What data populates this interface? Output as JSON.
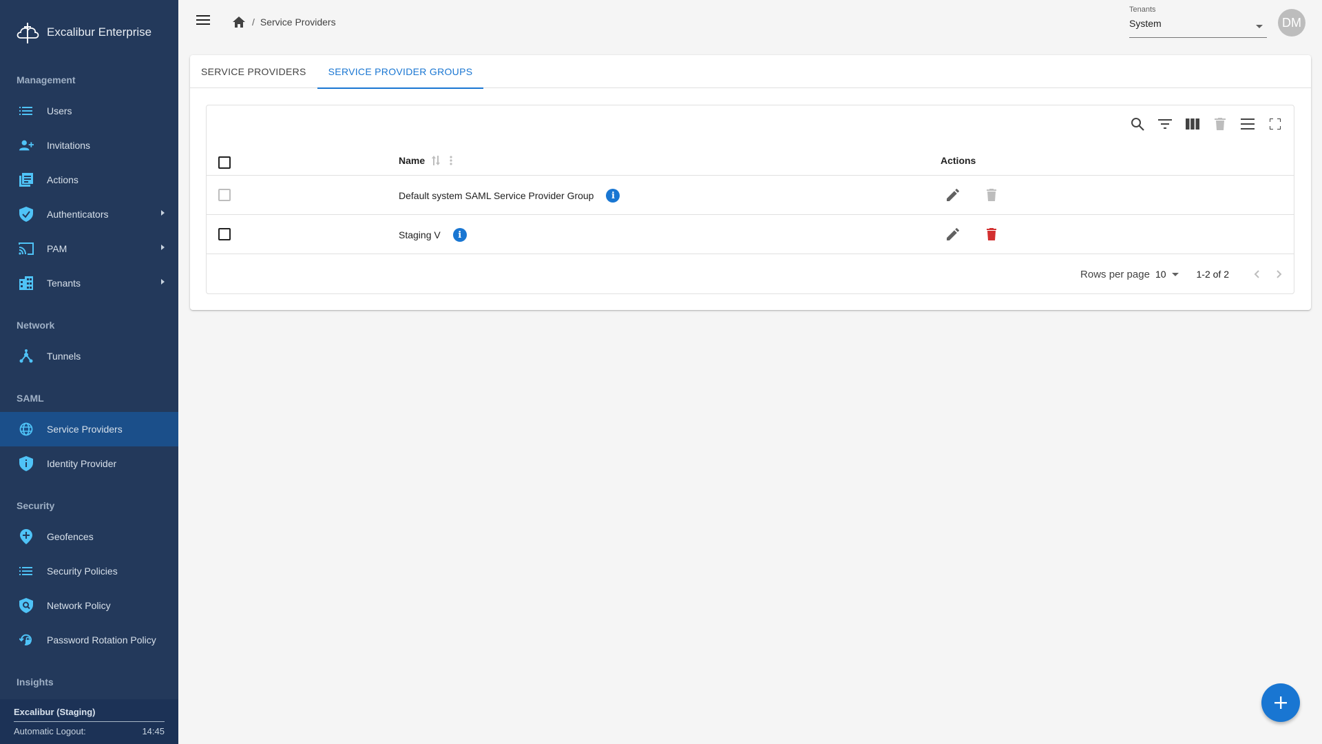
{
  "brand": {
    "name": "Excalibur Enterprise"
  },
  "sidebar": {
    "sections": {
      "management": "Management",
      "network": "Network",
      "saml": "SAML",
      "security": "Security",
      "insights": "Insights"
    },
    "items": {
      "users": "Users",
      "invitations": "Invitations",
      "actions": "Actions",
      "authenticators": "Authenticators",
      "pam": "PAM",
      "tenants": "Tenants",
      "tunnels": "Tunnels",
      "service_providers": "Service Providers",
      "identity_provider": "Identity Provider",
      "geofences": "Geofences",
      "security_policies": "Security Policies",
      "network_policy": "Network Policy",
      "password_rotation_policy": "Password Rotation Policy"
    },
    "footer": {
      "environment": "Excalibur (Staging)",
      "logout_label": "Automatic Logout:",
      "logout_time": "14:45"
    }
  },
  "header": {
    "breadcrumb_current": "Service Providers",
    "tenant_label": "Tenants",
    "tenant_value": "System",
    "avatar_initials": "DM"
  },
  "tabs": {
    "service_providers": "SERVICE PROVIDERS",
    "service_provider_groups": "SERVICE PROVIDER GROUPS"
  },
  "table": {
    "columns": {
      "name": "Name",
      "actions": "Actions"
    },
    "rows": [
      {
        "name": "Default system SAML Service Provider Group",
        "deletable": false
      },
      {
        "name": "Staging V",
        "deletable": true
      }
    ],
    "pagination": {
      "rows_per_page_label": "Rows per page",
      "rows_per_page_value": "10",
      "range": "1-2 of 2"
    }
  },
  "colors": {
    "sidebar_bg": "#23395b",
    "sidebar_active": "#1b4f8a",
    "accent": "#1976d2",
    "icon": "#4fc3f7",
    "danger": "#d32f2f"
  }
}
